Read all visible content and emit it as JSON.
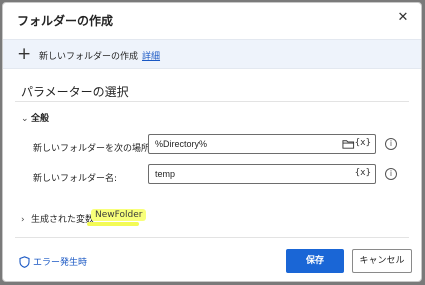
{
  "dialog": {
    "title": "フォルダーの作成",
    "close_glyph": "✕"
  },
  "banner": {
    "icon_glyph": "+",
    "description": "新しいフォルダーの作成",
    "details_link": "詳細"
  },
  "section": {
    "title": "パラメーターの選択"
  },
  "general": {
    "header": "全般",
    "chevron": "⌄",
    "fields": [
      {
        "label": "新しいフォルダーを次の場所に作成:",
        "value": "%Directory%",
        "fx": "{x}",
        "info": "i"
      },
      {
        "label": "新しいフォルダー名:",
        "value": "temp",
        "fx": "{x}",
        "info": "i"
      }
    ]
  },
  "generated": {
    "header": "生成された変数",
    "chevron": "›",
    "variable": "NewFolder",
    "highlight_color": "#f8ff7a"
  },
  "footer": {
    "on_error": "エラー発生時",
    "save": "保存",
    "cancel": "キャンセル"
  },
  "colors": {
    "accent": "#1a66d6",
    "link": "#1a58c4",
    "banner_bg": "#eef3fb"
  },
  "icons": {
    "close": "close-icon",
    "add": "plus-icon",
    "folder": "folder-icon",
    "variable": "variable-icon",
    "info": "info-icon",
    "shield": "shield-icon"
  }
}
